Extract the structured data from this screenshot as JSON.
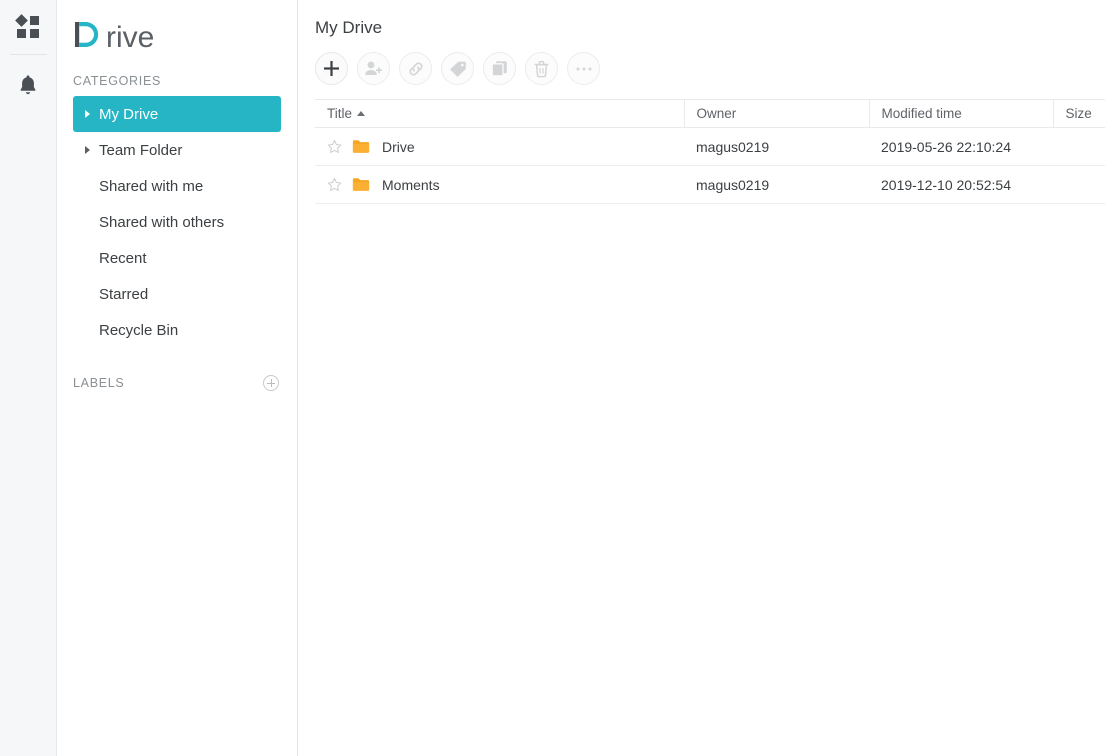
{
  "brand": {
    "name": "Drive",
    "accent_color": "#25b5c4",
    "text_color": "#4a4f55"
  },
  "rail": {
    "items": [
      {
        "icon": "apps-grid-icon",
        "name": "apps-grid"
      },
      {
        "icon": "bell-icon",
        "name": "notifications"
      }
    ]
  },
  "sidebar": {
    "categories_label": "CATEGORIES",
    "labels_label": "LABELS",
    "add_label_icon": "plus-circle-icon",
    "items": [
      {
        "label": "My Drive",
        "expandable": true,
        "active": true
      },
      {
        "label": "Team Folder",
        "expandable": true,
        "active": false
      },
      {
        "label": "Shared with me",
        "expandable": false,
        "active": false
      },
      {
        "label": "Shared with others",
        "expandable": false,
        "active": false
      },
      {
        "label": "Recent",
        "expandable": false,
        "active": false
      },
      {
        "label": "Starred",
        "expandable": false,
        "active": false
      },
      {
        "label": "Recycle Bin",
        "expandable": false,
        "active": false
      }
    ]
  },
  "main": {
    "title": "My Drive",
    "toolbar": [
      {
        "name": "new-button",
        "icon": "plus-icon",
        "enabled": true
      },
      {
        "name": "share-button",
        "icon": "person-add-icon",
        "enabled": false
      },
      {
        "name": "link-button",
        "icon": "link-icon",
        "enabled": false
      },
      {
        "name": "tag-button",
        "icon": "tag-icon",
        "enabled": false
      },
      {
        "name": "copy-button",
        "icon": "copy-icon",
        "enabled": false
      },
      {
        "name": "delete-button",
        "icon": "trash-icon",
        "enabled": false
      },
      {
        "name": "more-button",
        "icon": "ellipsis-icon",
        "enabled": false
      }
    ],
    "table": {
      "columns": [
        {
          "label": "Title",
          "sort": "asc"
        },
        {
          "label": "Owner",
          "sort": null
        },
        {
          "label": "Modified time",
          "sort": null
        },
        {
          "label": "Size",
          "sort": null
        }
      ],
      "rows": [
        {
          "starred": false,
          "kind": "folder",
          "title": "Drive",
          "owner": "magus0219",
          "modified": "2019-05-26 22:10:24",
          "size": ""
        },
        {
          "starred": false,
          "kind": "folder",
          "title": "Moments",
          "owner": "magus0219",
          "modified": "2019-12-10 20:52:54",
          "size": ""
        }
      ]
    }
  }
}
